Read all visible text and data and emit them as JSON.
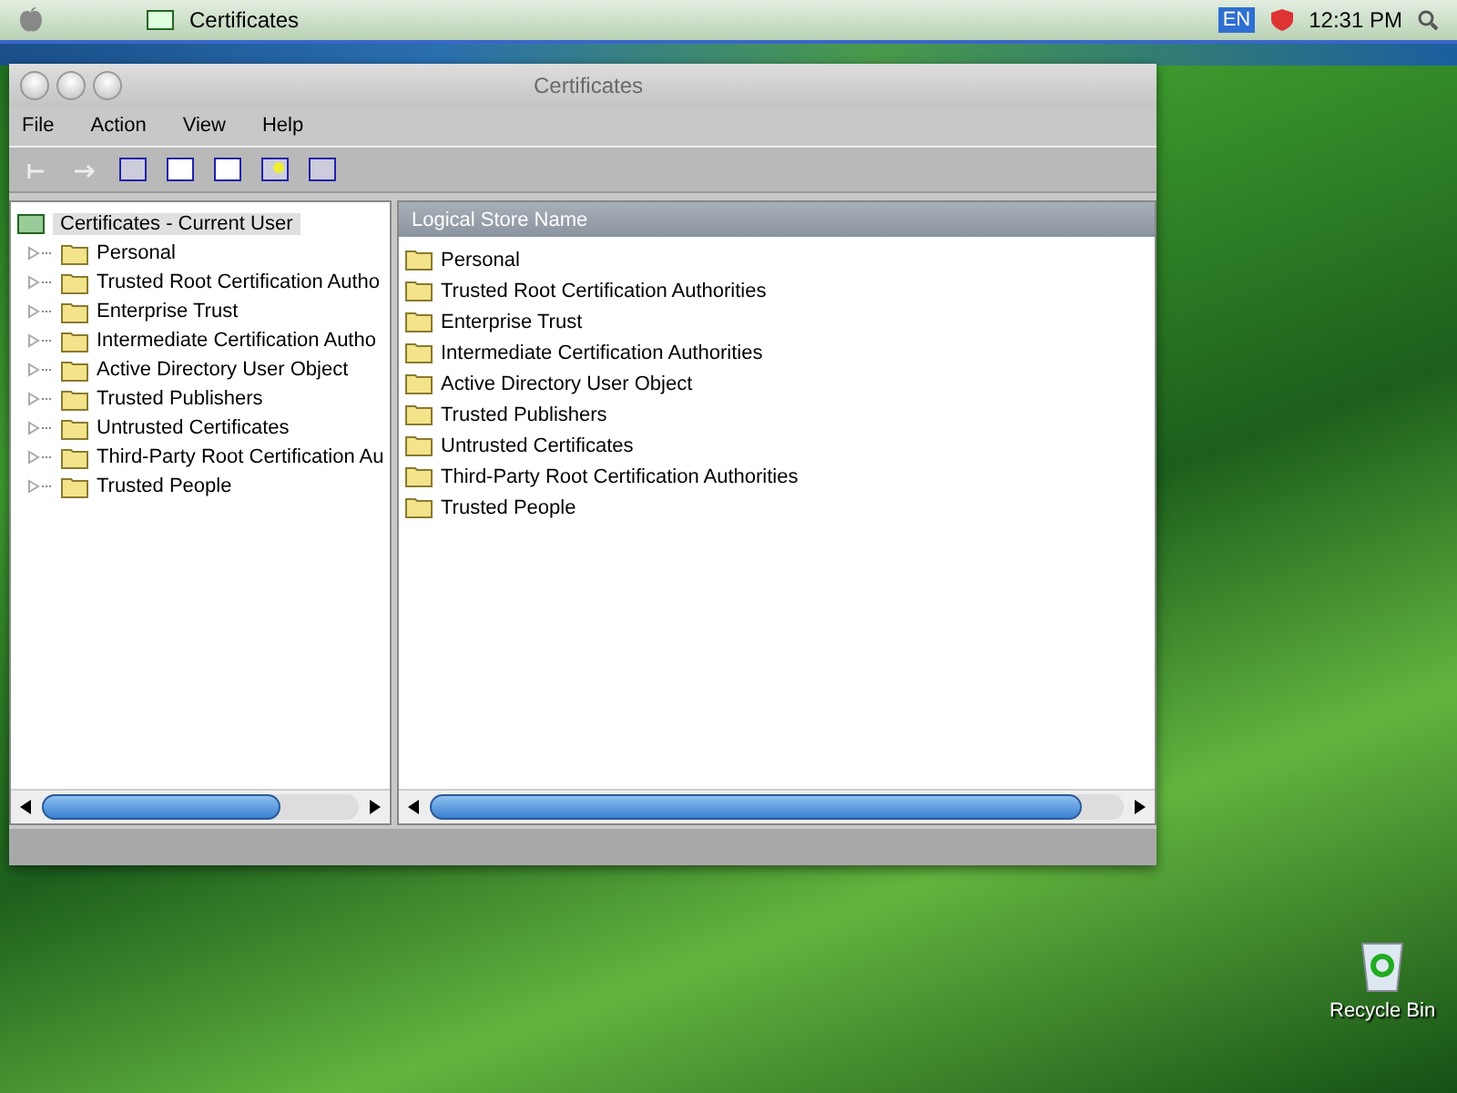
{
  "menubar": {
    "app_title": "Certificates",
    "input_language": "EN",
    "clock": "12:31 PM"
  },
  "window": {
    "title": "Certificates"
  },
  "menu": [
    "File",
    "Action",
    "View",
    "Help"
  ],
  "tree": {
    "label": "Certificates - Current User",
    "selected": true,
    "children": [
      {
        "label": "Personal"
      },
      {
        "label": "Trusted Root Certification Autho"
      },
      {
        "label": "Enterprise Trust"
      },
      {
        "label": "Intermediate Certification Autho"
      },
      {
        "label": "Active Directory User Object"
      },
      {
        "label": "Trusted Publishers"
      },
      {
        "label": "Untrusted Certificates"
      },
      {
        "label": "Third-Party Root Certification Au"
      },
      {
        "label": "Trusted People"
      }
    ]
  },
  "list": {
    "column": "Logical Store Name",
    "rows": [
      "Personal",
      "Trusted Root Certification Authorities",
      "Enterprise Trust",
      "Intermediate Certification Authorities",
      "Active Directory User Object",
      "Trusted Publishers",
      "Untrusted Certificates",
      "Third-Party Root Certification Authorities",
      "Trusted People"
    ]
  },
  "desktop_icons": [
    {
      "label": "Recycle Bin"
    }
  ]
}
